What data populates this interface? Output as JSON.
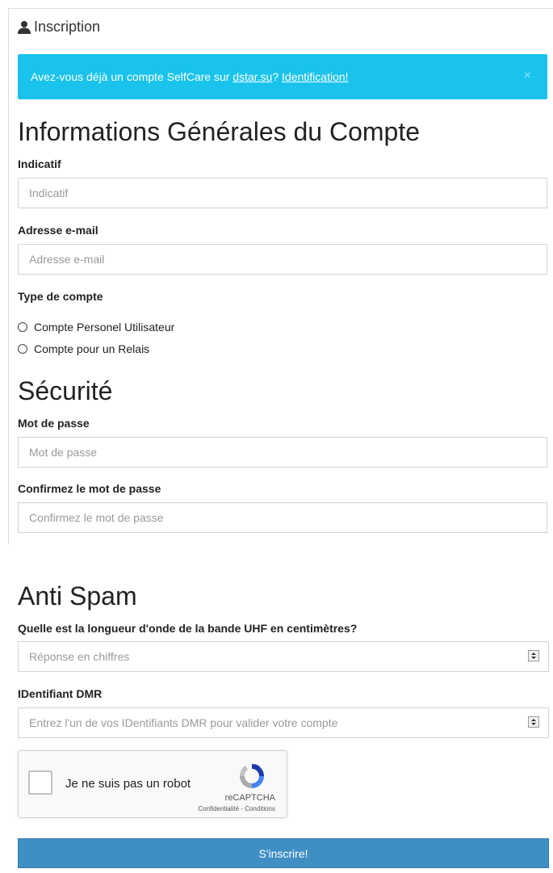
{
  "panel": {
    "title": "Inscription",
    "icon": "user-icon"
  },
  "alert": {
    "text_before": "Avez-vous déjà un compte SelfCare sur ",
    "site_link": "dstar.su",
    "text_middle": "? ",
    "login_link": "Identification!",
    "close": "×",
    "color": "#19c3ec"
  },
  "general": {
    "heading": "Informations Générales du Compte",
    "callsign": {
      "label": "Indicatif",
      "placeholder": "Indicatif"
    },
    "email": {
      "label": "Adresse e-mail",
      "placeholder": "Adresse e-mail"
    },
    "account_type": {
      "label": "Type de compte",
      "options": [
        "Compte Personel Utilisateur",
        "Compte pour un Relais"
      ]
    }
  },
  "security": {
    "heading": "Sécurité",
    "password": {
      "label": "Mot de passe",
      "placeholder": "Mot de passe"
    },
    "confirm": {
      "label": "Confirmez le mot de passe",
      "placeholder": "Confirmez le mot de passe"
    }
  },
  "antispam": {
    "heading": "Anti Spam",
    "question": {
      "label": "Quelle est la longueur d'onde de la bande UHF en centimètres?",
      "placeholder": "Réponse en chiffres"
    },
    "dmr": {
      "label": "IDentifiant DMR",
      "placeholder": "Entrez l'un de vos IDentifiants DMR pour valider votre compte"
    }
  },
  "captcha": {
    "label": "Je ne suis pas un robot",
    "brand": "reCAPTCHA",
    "links": "Confidentialité - Conditions"
  },
  "submit": {
    "label": "S'inscrire!",
    "color": "#3f8fc4"
  }
}
